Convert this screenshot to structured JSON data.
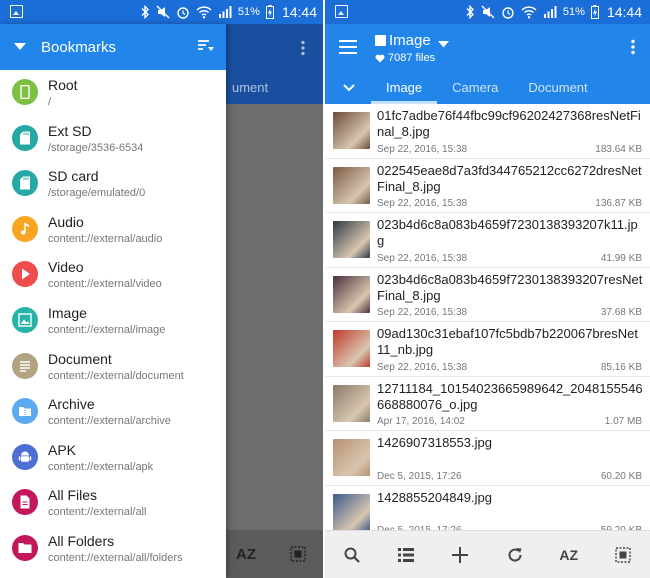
{
  "status_bar": {
    "battery": "51%",
    "time": "14:44"
  },
  "left": {
    "background_tab": "ument",
    "background_sort": "AZ",
    "drawer": {
      "title": "Bookmarks",
      "items": [
        {
          "name": "Root",
          "path": "/",
          "color": "#7cc142",
          "icon": "phone-icon"
        },
        {
          "name": "Ext SD",
          "path": "/storage/3536-6534",
          "color": "#26a9a6",
          "icon": "sd-card-icon"
        },
        {
          "name": "SD card",
          "path": "/storage/emulated/0",
          "color": "#26a9a6",
          "icon": "sd-card-icon"
        },
        {
          "name": "Audio",
          "path": "content://external/audio",
          "color": "#f6a623",
          "icon": "music-note-icon"
        },
        {
          "name": "Video",
          "path": "content://external/video",
          "color": "#ef4d4d",
          "icon": "play-icon"
        },
        {
          "name": "Image",
          "path": "content://external/image",
          "color": "#26b3a8",
          "icon": "image-icon"
        },
        {
          "name": "Document",
          "path": "content://external/document",
          "color": "#b3a380",
          "icon": "document-icon"
        },
        {
          "name": "Archive",
          "path": "content://external/archive",
          "color": "#5aaaf0",
          "icon": "archive-icon"
        },
        {
          "name": "APK",
          "path": "content://external/apk",
          "color": "#4c6fd1",
          "icon": "android-icon"
        },
        {
          "name": "All Files",
          "path": "content://external/all",
          "color": "#c2185b",
          "icon": "file-icon"
        },
        {
          "name": "All Folders",
          "path": "content://external/all/folders",
          "color": "#c2185b",
          "icon": "folder-icon"
        }
      ]
    }
  },
  "right": {
    "title": "Image",
    "subtitle": "7087 files",
    "tabs": [
      {
        "label": "Image",
        "active": true
      },
      {
        "label": "Camera",
        "active": false
      },
      {
        "label": "Document",
        "active": false
      }
    ],
    "files": [
      {
        "name": "01fc7adbe76f44fbc99cf96202427368resNetFinal_8.jpg",
        "date": "Sep 22, 2016, 15:38",
        "size": "183.64 KB",
        "thumb": "#6b4a3a"
      },
      {
        "name": "022545eae8d7a3fd344765212cc6272dresNetFinal_8.jpg",
        "date": "Sep 22, 2016, 15:38",
        "size": "136.87 KB",
        "thumb": "#7a5a44"
      },
      {
        "name": "023b4d6c8a083b4659f7230138393207k11.jpg",
        "date": "Sep 22, 2016, 15:38",
        "size": "41.99 KB",
        "thumb": "#2d3a45"
      },
      {
        "name": "023b4d6c8a083b4659f7230138393207resNetFinal_8.jpg",
        "date": "Sep 22, 2016, 15:38",
        "size": "37.68 KB",
        "thumb": "#4a2f3c"
      },
      {
        "name": "09ad130c31ebaf107fc5bdb7b220067bresNet11_nb.jpg",
        "date": "Sep 22, 2016, 15:38",
        "size": "85.16 KB",
        "thumb": "#c0392b"
      },
      {
        "name": "12711184_10154023665989642_2048155546668880076_o.jpg",
        "date": "Apr 17, 2016, 14:02",
        "size": "1.07 MB",
        "thumb": "#8a7a6a"
      },
      {
        "name": "1426907318553.jpg",
        "date": "Dec 5, 2015, 17:26",
        "size": "60.20 KB",
        "thumb": "#b89070"
      },
      {
        "name": "1428855204849.jpg",
        "date": "Dec 5, 2015, 17:26",
        "size": "59.20 KB",
        "thumb": "#3a5a8a"
      }
    ],
    "bottom_sort": "AZ"
  }
}
